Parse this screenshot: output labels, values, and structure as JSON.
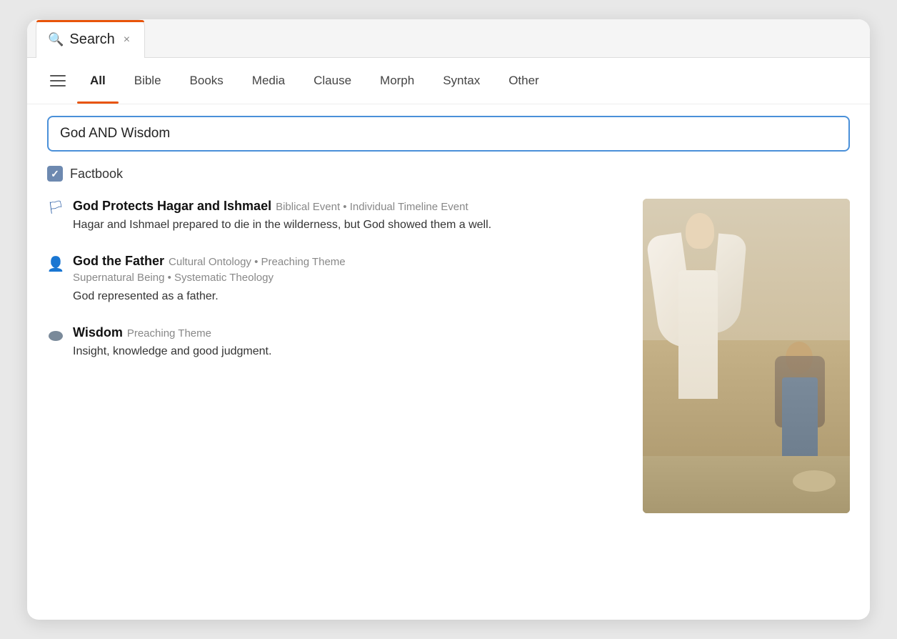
{
  "tab": {
    "label": "Search",
    "close": "×"
  },
  "nav": {
    "tabs": [
      {
        "id": "all",
        "label": "All",
        "active": true
      },
      {
        "id": "bible",
        "label": "Bible",
        "active": false
      },
      {
        "id": "books",
        "label": "Books",
        "active": false
      },
      {
        "id": "media",
        "label": "Media",
        "active": false
      },
      {
        "id": "clause",
        "label": "Clause",
        "active": false
      },
      {
        "id": "morph",
        "label": "Morph",
        "active": false
      },
      {
        "id": "syntax",
        "label": "Syntax",
        "active": false
      },
      {
        "id": "other",
        "label": "Other",
        "active": false
      }
    ]
  },
  "search": {
    "value": "God AND Wisdom",
    "placeholder": "Search..."
  },
  "factbook": {
    "label": "Factbook"
  },
  "results": [
    {
      "id": "result-1",
      "icon": "flag",
      "title": "God Protects Hagar and Ishmael",
      "tags": "Biblical Event • Individual Timeline  Event",
      "subtitle": "",
      "description": "Hagar and Ishmael prepared to die in the wilderness, but God showed them  a well."
    },
    {
      "id": "result-2",
      "icon": "person",
      "title": "God the Father",
      "tags": "Cultural Ontology • Preaching Theme",
      "subtitle": "Supernatural Being • Systematic Theology",
      "description": "God represented as a father."
    },
    {
      "id": "result-3",
      "icon": "ellipse",
      "title": "Wisdom",
      "tags": "Preaching Theme",
      "subtitle": "",
      "description": "Insight, knowledge and good judgment."
    }
  ]
}
